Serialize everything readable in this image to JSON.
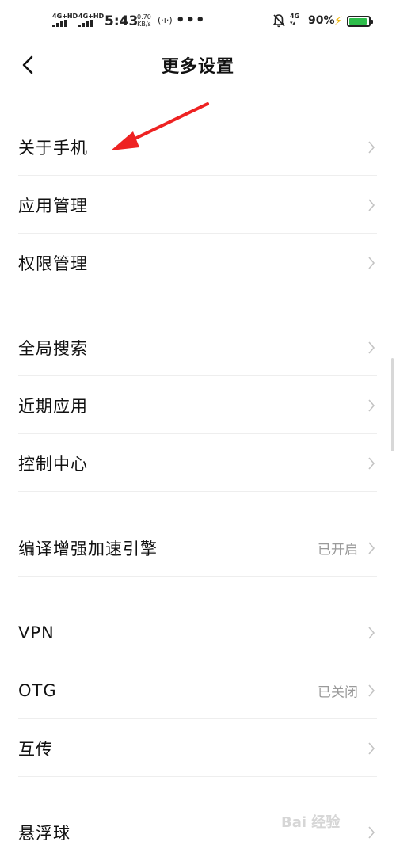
{
  "status_bar": {
    "sim1_network": "4G+HD",
    "sim2_network": "4G+HD",
    "time": "5:43",
    "speed_value": "0.70",
    "speed_unit": "KB/s",
    "hotspot_icon": "hotspot-icon",
    "more_dots": "•••",
    "bell_icon": "bell-off-icon",
    "data_network": "4G",
    "battery_percent": "90%",
    "battery_level": 0.9,
    "charging_icon": "bolt-icon",
    "battery_color": "#2dbd4a"
  },
  "header": {
    "back_icon": "back-arrow-icon",
    "title": "更多设置"
  },
  "items": [
    {
      "label": "关于手机",
      "value": ""
    },
    {
      "label": "应用管理",
      "value": ""
    },
    {
      "label": "权限管理",
      "value": ""
    },
    {
      "label": "全局搜索",
      "value": ""
    },
    {
      "label": "近期应用",
      "value": ""
    },
    {
      "label": "控制中心",
      "value": ""
    },
    {
      "label": "编译增强加速引擎",
      "value": "已开启"
    },
    {
      "label": "VPN",
      "value": ""
    },
    {
      "label": "OTG",
      "value": "已关闭"
    },
    {
      "label": "互传",
      "value": ""
    },
    {
      "label": "悬浮球",
      "value": ""
    }
  ],
  "annotation": {
    "arrow_color": "#ee2222"
  },
  "watermark": {
    "text": "Bai 经验"
  }
}
